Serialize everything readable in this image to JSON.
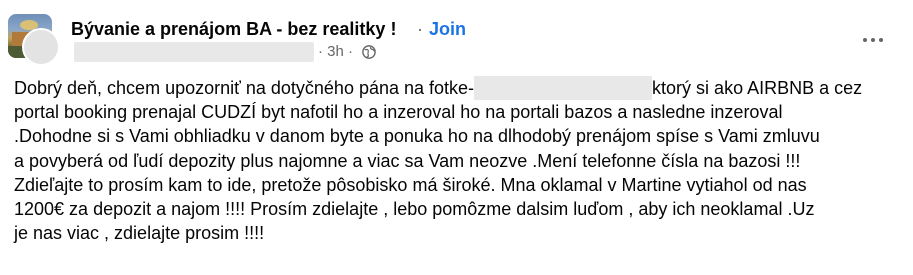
{
  "post": {
    "group_name": "Bývanie a prenájom BA - bez realitky !",
    "separator": "·",
    "join_label": "Join",
    "timestamp": "3h",
    "meta_separator": "·",
    "privacy_icon": "globe-icon",
    "more_icon": "more-options-icon",
    "text_lines": [
      {
        "before": "Dobrý deň, chcem upozorniť na dotyčného pána na fotke-",
        "after": "ktorý si ako AIRBNB a cez"
      },
      {
        "text": "portal booking prenajal CUDZÍ byt  nafotil ho a inzeroval ho na portali bazos a nasledne inzeroval"
      },
      {
        "text": ".Dohodne  si s Vami obhliadku v danom byte a ponuka ho na dlhodobý prenájom spíse s Vami zmluvu"
      },
      {
        "text": "a povyberá od ľudí depozity plus najomne a viac sa Vam neozve .Mení telefonne čísla na bazosi !!!"
      },
      {
        "text": "Zdieľajte to prosím kam to ide, pretože pôsobisko má široké. Mna oklamal v Martine vytiahol od nas"
      },
      {
        "text": "1200€ za depozit a najom !!!! Prosím zdielajte , lebo pomôzme dalsim luďom , aby ich neoklamal .Uz"
      },
      {
        "text": "je nas viac , zdielajte prosim !!!!"
      }
    ]
  },
  "colors": {
    "text": "#050505",
    "secondary": "#65676b",
    "link": "#1b74e4",
    "redaction": "#e8e8e8"
  }
}
